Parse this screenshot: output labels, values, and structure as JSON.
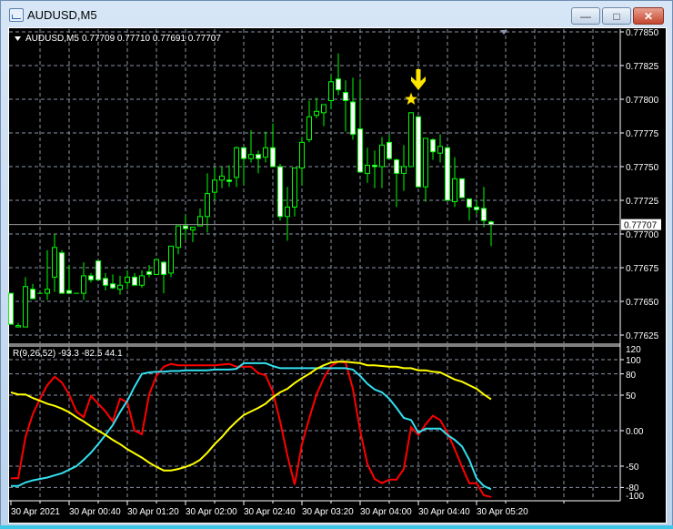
{
  "window": {
    "title": "AUDUSD,M5",
    "minimize": "—",
    "maximize": "□",
    "close": "✕"
  },
  "colors": {
    "background": "#000000",
    "candle_outline": "#00ff00",
    "bear_fill": "#ffffff",
    "bull_fill": "#000000",
    "grid": "#8a94a6",
    "series1": "#ff0000",
    "series2": "#33e0f0",
    "series3": "#ffff00",
    "marker": "#ffe600"
  },
  "legend": {
    "symbol": "AUDUSD,M5",
    "ohlc": "0.77709 0.77710 0.77691 0.77707"
  },
  "indicator_legend": "R(9,26,52) -93.3 -82.5 44.1",
  "current_price": "0.77707",
  "price_axis": [
    "0.77850",
    "0.77825",
    "0.77800",
    "0.77775",
    "0.77750",
    "0.77725",
    "0.77700",
    "0.77675",
    "0.77650",
    "0.77625"
  ],
  "indicator_axis": [
    "120",
    "100",
    "80",
    "50",
    "0.00",
    "-50",
    "-80",
    "-100"
  ],
  "time_axis": [
    "30 Apr 2021",
    "30 Apr 00:40",
    "30 Apr 01:20",
    "30 Apr 02:00",
    "30 Apr 02:40",
    "30 Apr 03:20",
    "30 Apr 04:00",
    "30 Apr 04:40",
    "30 Apr 05:20"
  ],
  "markers": [
    {
      "type": "star",
      "candle": 55,
      "price": 0.778
    },
    {
      "type": "down-arrow",
      "candle": 56
    }
  ],
  "chart_data": [
    {
      "type": "candlestick",
      "symbol": "AUDUSD",
      "timeframe": "M5",
      "ylim": [
        0.7762,
        0.77855
      ],
      "grid": true,
      "ohlc": [
        [
          0.77656,
          0.77656,
          0.77633,
          0.77633
        ],
        [
          0.77631,
          0.77634,
          0.77631,
          0.77632
        ],
        [
          0.77631,
          0.77668,
          0.77631,
          0.77661
        ],
        [
          0.77659,
          0.77663,
          0.77652,
          0.77652
        ],
        [
          0.77656,
          0.77656,
          0.77656,
          0.77656
        ],
        [
          0.77656,
          0.77688,
          0.77651,
          0.77659
        ],
        [
          0.77668,
          0.777,
          0.77657,
          0.7769
        ],
        [
          0.77686,
          0.77688,
          0.77656,
          0.77656
        ],
        [
          0.77658,
          0.77677,
          0.77656,
          0.77656
        ],
        [
          0.77656,
          0.77656,
          0.77656,
          0.77656
        ],
        [
          0.77656,
          0.77679,
          0.77651,
          0.77669
        ],
        [
          0.77669,
          0.77671,
          0.77664,
          0.77666
        ],
        [
          0.7768,
          0.7768,
          0.77666,
          0.77666
        ],
        [
          0.77667,
          0.77671,
          0.77658,
          0.77662
        ],
        [
          0.77663,
          0.7767,
          0.77659,
          0.7766
        ],
        [
          0.77659,
          0.77669,
          0.77655,
          0.77662
        ],
        [
          0.77664,
          0.77673,
          0.77659,
          0.77668
        ],
        [
          0.77668,
          0.77671,
          0.77662,
          0.77662
        ],
        [
          0.77662,
          0.77673,
          0.7766,
          0.77669
        ],
        [
          0.77672,
          0.77677,
          0.77668,
          0.7767
        ],
        [
          0.7767,
          0.77682,
          0.7767,
          0.77681
        ],
        [
          0.77679,
          0.7768,
          0.77656,
          0.7767
        ],
        [
          0.77671,
          0.77691,
          0.77668,
          0.77691
        ],
        [
          0.7769,
          0.77706,
          0.77685,
          0.77706
        ],
        [
          0.77706,
          0.77714,
          0.77696,
          0.77704
        ],
        [
          0.77703,
          0.77705,
          0.77694,
          0.77705
        ],
        [
          0.77706,
          0.77719,
          0.77706,
          0.77713
        ],
        [
          0.77713,
          0.77745,
          0.77701,
          0.7773
        ],
        [
          0.77731,
          0.7775,
          0.77725,
          0.7774
        ],
        [
          0.7774,
          0.7775,
          0.77734,
          0.77743
        ],
        [
          0.7774,
          0.77751,
          0.77735,
          0.77739
        ],
        [
          0.77742,
          0.77765,
          0.77735,
          0.77764
        ],
        [
          0.77764,
          0.77765,
          0.77736,
          0.77756
        ],
        [
          0.77756,
          0.77777,
          0.77753,
          0.77759
        ],
        [
          0.77759,
          0.77762,
          0.77745,
          0.77756
        ],
        [
          0.77757,
          0.77776,
          0.77753,
          0.77764
        ],
        [
          0.77764,
          0.77782,
          0.7775,
          0.7775
        ],
        [
          0.7775,
          0.77752,
          0.7771,
          0.77713
        ],
        [
          0.77713,
          0.77735,
          0.77695,
          0.7772
        ],
        [
          0.7772,
          0.77749,
          0.77713,
          0.77749
        ],
        [
          0.77749,
          0.77772,
          0.77736,
          0.77768
        ],
        [
          0.7777,
          0.77799,
          0.77768,
          0.77787
        ],
        [
          0.77788,
          0.77801,
          0.77786,
          0.77791
        ],
        [
          0.7779,
          0.77796,
          0.7778,
          0.77796
        ],
        [
          0.77799,
          0.77818,
          0.77793,
          0.77813
        ],
        [
          0.77815,
          0.77834,
          0.77803,
          0.77807
        ],
        [
          0.77805,
          0.77814,
          0.77776,
          0.77799
        ],
        [
          0.77798,
          0.77816,
          0.7777,
          0.77774
        ],
        [
          0.77778,
          0.77815,
          0.77746,
          0.77746
        ],
        [
          0.77745,
          0.77764,
          0.77738,
          0.77751
        ],
        [
          0.77751,
          0.77762,
          0.77734,
          0.7775
        ],
        [
          0.7775,
          0.77772,
          0.77734,
          0.77766
        ],
        [
          0.77768,
          0.77774,
          0.77756,
          0.77756
        ],
        [
          0.77755,
          0.77756,
          0.7772,
          0.77745
        ],
        [
          0.77745,
          0.77766,
          0.77732,
          0.7775
        ],
        [
          0.7775,
          0.7779,
          0.7775,
          0.7779
        ],
        [
          0.77787,
          0.77787,
          0.77735,
          0.77735
        ],
        [
          0.77735,
          0.77771,
          0.77724,
          0.77771
        ],
        [
          0.7777,
          0.77771,
          0.77755,
          0.77761
        ],
        [
          0.7776,
          0.77774,
          0.77753,
          0.77765
        ],
        [
          0.77764,
          0.77764,
          0.77725,
          0.77725
        ],
        [
          0.77724,
          0.77757,
          0.7772,
          0.77741
        ],
        [
          0.77741,
          0.77741,
          0.77727,
          0.77727
        ],
        [
          0.77726,
          0.77726,
          0.7771,
          0.7772
        ],
        [
          0.7772,
          0.77725,
          0.77715,
          0.77718
        ],
        [
          0.77719,
          0.77735,
          0.77705,
          0.7771
        ],
        [
          0.77709,
          0.7771,
          0.77691,
          0.77707
        ]
      ]
    },
    {
      "type": "line",
      "ylim": [
        -100,
        120
      ],
      "levels": [
        100,
        80,
        50,
        0,
        -50,
        -80
      ],
      "grid": true,
      "series": [
        {
          "color": "#ff0000",
          "values": [
            -67,
            -67,
            -9,
            23,
            45,
            64,
            76,
            68,
            51,
            27,
            19,
            49,
            38,
            27,
            13,
            45,
            40,
            0,
            -5,
            51,
            77,
            90,
            94,
            92,
            92,
            92,
            92,
            92,
            92,
            93,
            94,
            90,
            90,
            90,
            81,
            78,
            55,
            13,
            -35,
            -76,
            -19,
            17,
            51,
            74,
            91,
            97,
            96,
            59,
            0,
            -47,
            -68,
            -74,
            -69,
            -69,
            -54,
            5,
            -6,
            9,
            21,
            15,
            -3,
            -26,
            -51,
            -74,
            -74,
            -91,
            -93.3
          ]
        },
        {
          "color": "#33e0f0",
          "values": [
            -78,
            -78,
            -73,
            -70,
            -68,
            -66,
            -63,
            -60,
            -55,
            -50,
            -41,
            -31,
            -19,
            -6,
            8,
            26,
            42,
            62,
            80,
            82,
            83,
            83,
            84,
            84,
            85,
            85,
            85,
            85,
            86,
            86,
            86,
            87,
            95,
            95,
            95,
            95,
            91,
            88,
            88,
            88,
            88,
            88,
            88,
            88,
            88,
            88,
            88,
            86,
            77,
            66,
            58,
            54,
            45,
            32,
            18,
            15,
            -3,
            3,
            3,
            3,
            -6,
            -13,
            -22,
            -41,
            -67,
            -78,
            -82.5
          ]
        },
        {
          "color": "#ffff00",
          "values": [
            54,
            51,
            51,
            46,
            42,
            38,
            35,
            31,
            26,
            19,
            13,
            6,
            0,
            -6,
            -13,
            -19,
            -26,
            -32,
            -38,
            -45,
            -51,
            -56,
            -56,
            -54,
            -51,
            -47,
            -41,
            -31,
            -19,
            -9,
            3,
            13,
            22,
            27,
            32,
            38,
            47,
            54,
            59,
            67,
            74,
            80,
            87,
            92,
            96,
            97,
            97,
            96,
            95,
            92,
            92,
            91,
            90,
            90,
            88,
            88,
            85,
            85,
            83,
            82,
            77,
            72,
            69,
            64,
            59,
            51,
            44.1
          ]
        }
      ]
    }
  ]
}
